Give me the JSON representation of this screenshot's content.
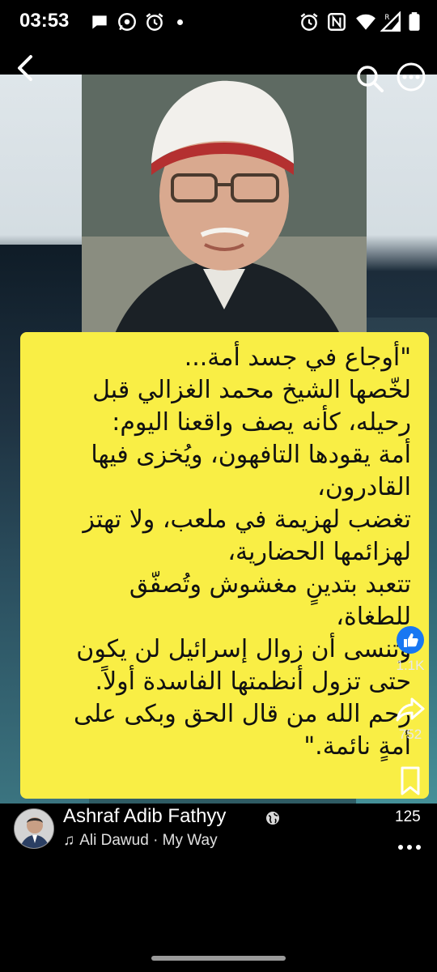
{
  "status_bar": {
    "time": "03:53",
    "left_icons": [
      "chat-bubble-icon",
      "whatsapp-icon",
      "alarm-icon"
    ],
    "right_icons": [
      "alarm-icon",
      "nfc-icon",
      "wifi-icon",
      "signal-icon",
      "battery-icon"
    ]
  },
  "top_bar": {
    "back_icon": "chevron-left-icon",
    "search_icon": "search-icon",
    "more_icon": "more-horizontal-icon"
  },
  "post": {
    "quote_lines": [
      "\"أوجاع في جسد أمة...",
      "لخّصها الشيخ محمد الغزالي قبل",
      "رحيله، كأنه يصف واقعنا اليوم:",
      "أمة يقودها التافهون، ويُخزى فيها",
      "القادرون،",
      "تغضب لهزيمة في ملعب، ولا تهتز",
      "لهزائمها الحضارية،",
      "تتعبد بتدينٍ مغشوش وتُصفّق",
      "للطغاة،",
      "وتنسى أن زوال إسرائيل لن يكون",
      "حتى تزول أنظمتها الفاسدة أولاً.",
      "رحم الله من قال الحق وبكى على",
      "أمةٍ نائمة.\""
    ]
  },
  "actions": {
    "like_count": "1.1K",
    "share_count": "752",
    "like_color": "#1877f2"
  },
  "footer": {
    "author_name": "Ashraf Adib Fathyy",
    "music_note": "♫",
    "music_text": "Ali Dawud · My Way",
    "count": "125"
  }
}
